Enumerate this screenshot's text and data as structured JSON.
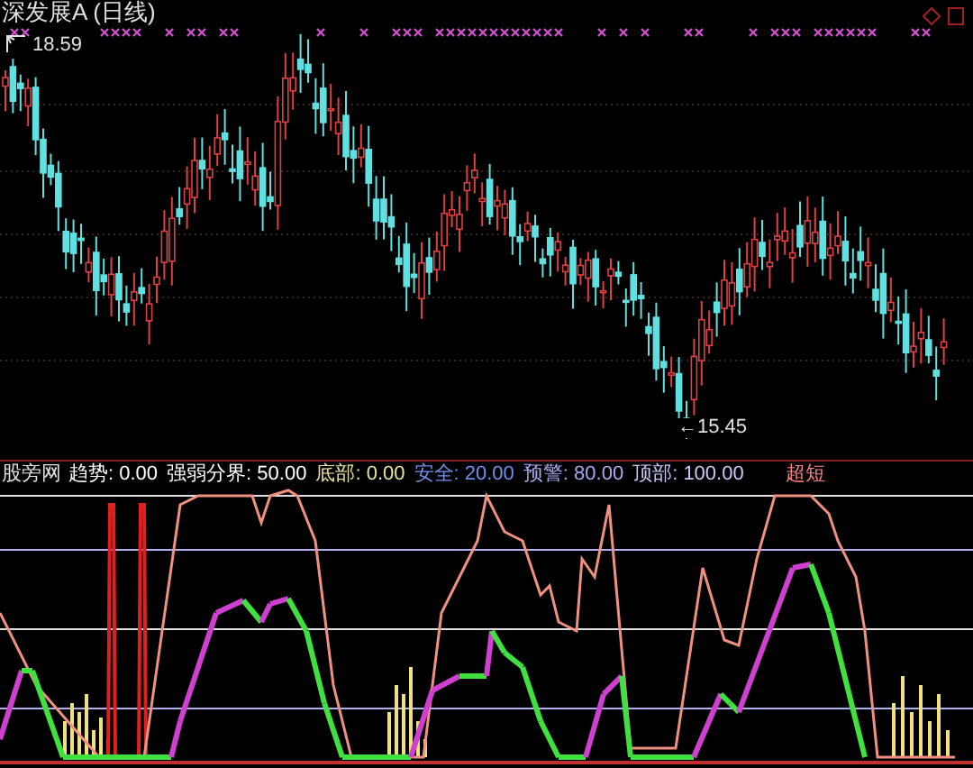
{
  "chart": {
    "title": "深发展A",
    "period": "(日线)",
    "high_label": "18.59",
    "low_label": "←15.45"
  },
  "indicator": {
    "name": "股旁网",
    "values": [
      {
        "label": "趋势:",
        "value": "0.00",
        "color": "#ffffff"
      },
      {
        "label": "强弱分界:",
        "value": "50.00",
        "color": "#ffffff"
      },
      {
        "label": "底部:",
        "value": "0.00",
        "color": "#e8e0a0"
      },
      {
        "label": "安全:",
        "value": "20.00",
        "color": "#6f8fe8"
      },
      {
        "label": "预警:",
        "value": "80.00",
        "color": "#a8a8f0"
      },
      {
        "label": "顶部:",
        "value": "100.00",
        "color": "#c8c8f8"
      }
    ],
    "overflow_label": "超短"
  }
}
